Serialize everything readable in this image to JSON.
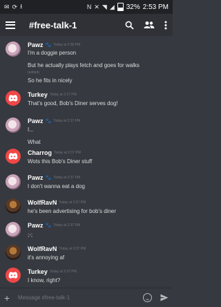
{
  "statusbar": {
    "battery": "32%",
    "time": "2:53 PM"
  },
  "header": {
    "channel": "#free-talk-1"
  },
  "messages": [
    {
      "user": "Pawz",
      "time": "Today at 2:36 PM",
      "avatar": "pawz",
      "lines": [
        "I'm a doggie person",
        "But he actually plays fetch and goes for walks",
        "So he fits in nicely"
      ],
      "edited": "(edited)"
    },
    {
      "user": "Turkey",
      "time": "Today at 2:37 PM",
      "avatar": "discord",
      "lines": [
        "That's good, Bob's Diner serves dog!"
      ]
    },
    {
      "user": "Pawz",
      "time": "Today at 2:37 PM",
      "avatar": "pawz",
      "lines": [
        "I...",
        "What"
      ]
    },
    {
      "user": "Charrog",
      "time": "Today at 2:37 PM",
      "avatar": "discord",
      "lines": [
        "Wots this Bob's Diner stuff"
      ]
    },
    {
      "user": "Pawz",
      "time": "Today at 2:37 PM",
      "avatar": "pawz",
      "lines": [
        "I don't wanna eat a dog"
      ]
    },
    {
      "user": "WolfRavN",
      "time": "Today at 2:37 PM",
      "avatar": "wolf",
      "lines": [
        "he's been advertising for bob's diner"
      ]
    },
    {
      "user": "Pawz",
      "time": "Today at 2:37 PM",
      "avatar": "pawz",
      "lines": [
        ";-;"
      ]
    },
    {
      "user": "WolfRavN",
      "time": "Today at 2:37 PM",
      "avatar": "wolf",
      "lines": [
        "it's annoying af"
      ]
    },
    {
      "user": "Turkey",
      "time": "Today at 2:37 PM",
      "avatar": "discord",
      "lines": [
        "I know, right?"
      ]
    }
  ],
  "input": {
    "placeholder": "Message #free-talk-1"
  }
}
